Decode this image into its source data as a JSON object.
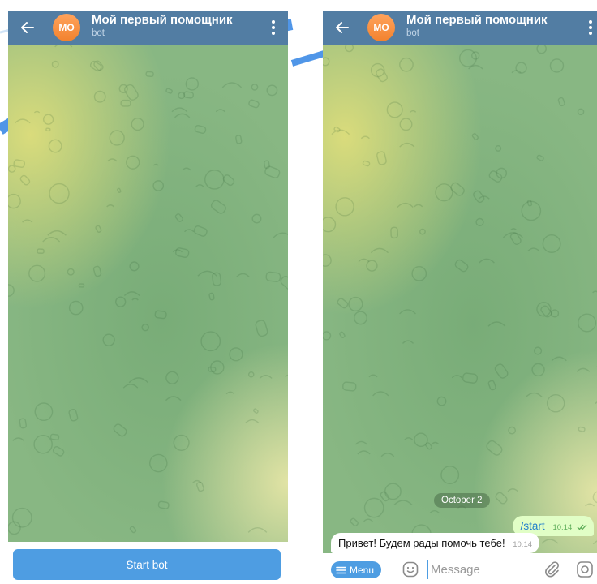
{
  "colors": {
    "header": "#527da3",
    "accent": "#4e9de2",
    "outgoing_bubble": "#e1fec6",
    "incoming_bubble": "#ffffff",
    "wallpaper": "#88b783"
  },
  "chat_header": {
    "avatar_initials": "MO",
    "title": "Мой первый помощник",
    "subtitle": "bot"
  },
  "left_screen": {
    "start_button_label": "Start bot"
  },
  "right_screen": {
    "date_separator": "October 2",
    "messages": [
      {
        "direction": "outgoing",
        "text": "/start",
        "time": "10:14",
        "status": "read"
      },
      {
        "direction": "incoming",
        "text": "Привет! Будем рады помочь тебе!",
        "time": "10:14"
      }
    ],
    "input_bar": {
      "menu_label": "Menu",
      "message_placeholder": "Message"
    }
  },
  "icons": {
    "back": "arrow-left-icon",
    "more": "vertical-dots-icon",
    "read_receipt": "double-check-icon",
    "emoji": "smiley-icon",
    "attach": "paperclip-icon",
    "camera": "camera-icon"
  }
}
